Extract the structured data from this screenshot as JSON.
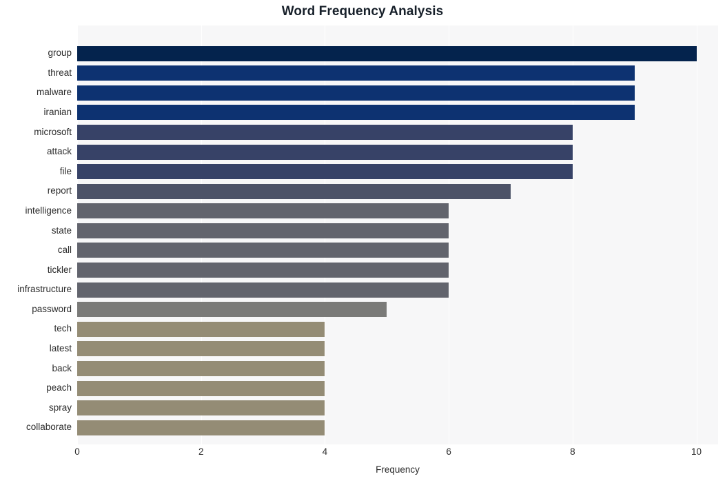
{
  "chart_data": {
    "type": "bar",
    "orientation": "horizontal",
    "title": "Word Frequency Analysis",
    "xlabel": "Frequency",
    "ylabel": "",
    "categories": [
      "group",
      "threat",
      "malware",
      "iranian",
      "microsoft",
      "attack",
      "file",
      "report",
      "intelligence",
      "state",
      "call",
      "tickler",
      "infrastructure",
      "password",
      "tech",
      "latest",
      "back",
      "peach",
      "spray",
      "collaborate"
    ],
    "values": [
      10,
      9,
      9,
      9,
      8,
      8,
      8,
      7,
      6,
      6,
      6,
      6,
      6,
      5,
      4,
      4,
      4,
      4,
      4,
      4
    ],
    "bar_colors": [
      "#04234d",
      "#0d3271",
      "#0d3271",
      "#0d3271",
      "#374267",
      "#374267",
      "#374267",
      "#4d5368",
      "#62646d",
      "#62646d",
      "#62646d",
      "#62646d",
      "#62646d",
      "#7a7a78",
      "#948c75",
      "#948c75",
      "#948c75",
      "#948c75",
      "#948c75",
      "#948c75"
    ],
    "xlim": [
      0,
      10.35
    ],
    "xticks": [
      0,
      2,
      4,
      6,
      8,
      10
    ],
    "xtick_labels": [
      "0",
      "2",
      "4",
      "6",
      "8",
      "10"
    ],
    "grid": true,
    "grid_axis": "x",
    "grid_color": "#ffffff",
    "plot_background": "#f7f7f8",
    "figure_background": "#ffffff",
    "legend": null,
    "legend_position": "none"
  }
}
